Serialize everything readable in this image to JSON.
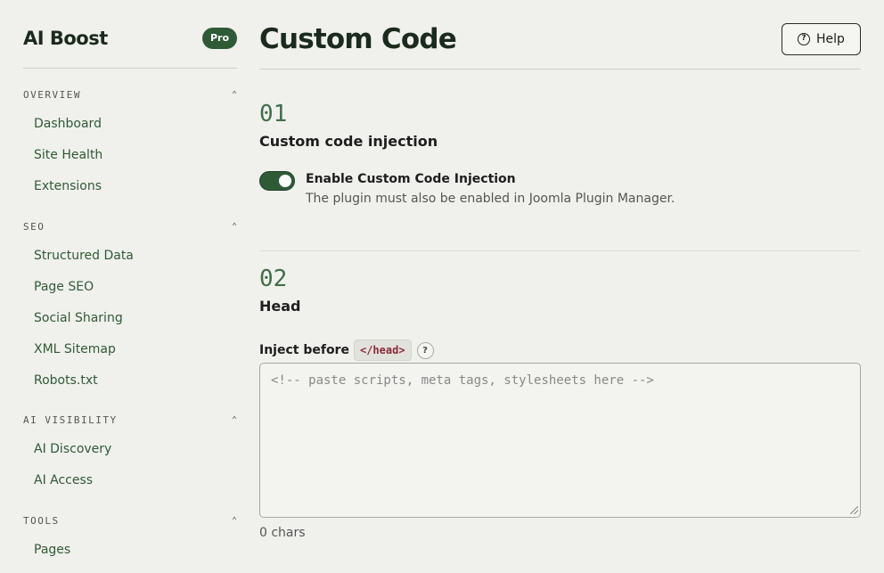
{
  "sidebar": {
    "brand": "AI Boost",
    "badge": "Pro",
    "sections": [
      {
        "title": "OVERVIEW",
        "items": [
          "Dashboard",
          "Site Health",
          "Extensions"
        ]
      },
      {
        "title": "SEO",
        "items": [
          "Structured Data",
          "Page SEO",
          "Social Sharing",
          "XML Sitemap",
          "Robots.txt"
        ]
      },
      {
        "title": "AI VISIBILITY",
        "items": [
          "AI Discovery",
          "AI Access"
        ]
      },
      {
        "title": "TOOLS",
        "items": [
          "Pages"
        ]
      }
    ]
  },
  "header": {
    "title": "Custom Code",
    "help_label": "Help"
  },
  "step1": {
    "number": "01",
    "title": "Custom code injection",
    "toggle_label": "Enable Custom Code Injection",
    "toggle_desc": "The plugin must also be enabled in Joomla Plugin Manager.",
    "enabled": true
  },
  "step2": {
    "number": "02",
    "title": "Head",
    "inject_label": "Inject before",
    "tag": "</head>",
    "tip": "?",
    "placeholder": "<!-- paste scripts, meta tags, stylesheets here -->",
    "value": "",
    "char_count": "0 chars"
  },
  "colors": {
    "accent": "#2f5a36",
    "background": "#f0f0ec",
    "tag_text": "#8a2a3c"
  }
}
